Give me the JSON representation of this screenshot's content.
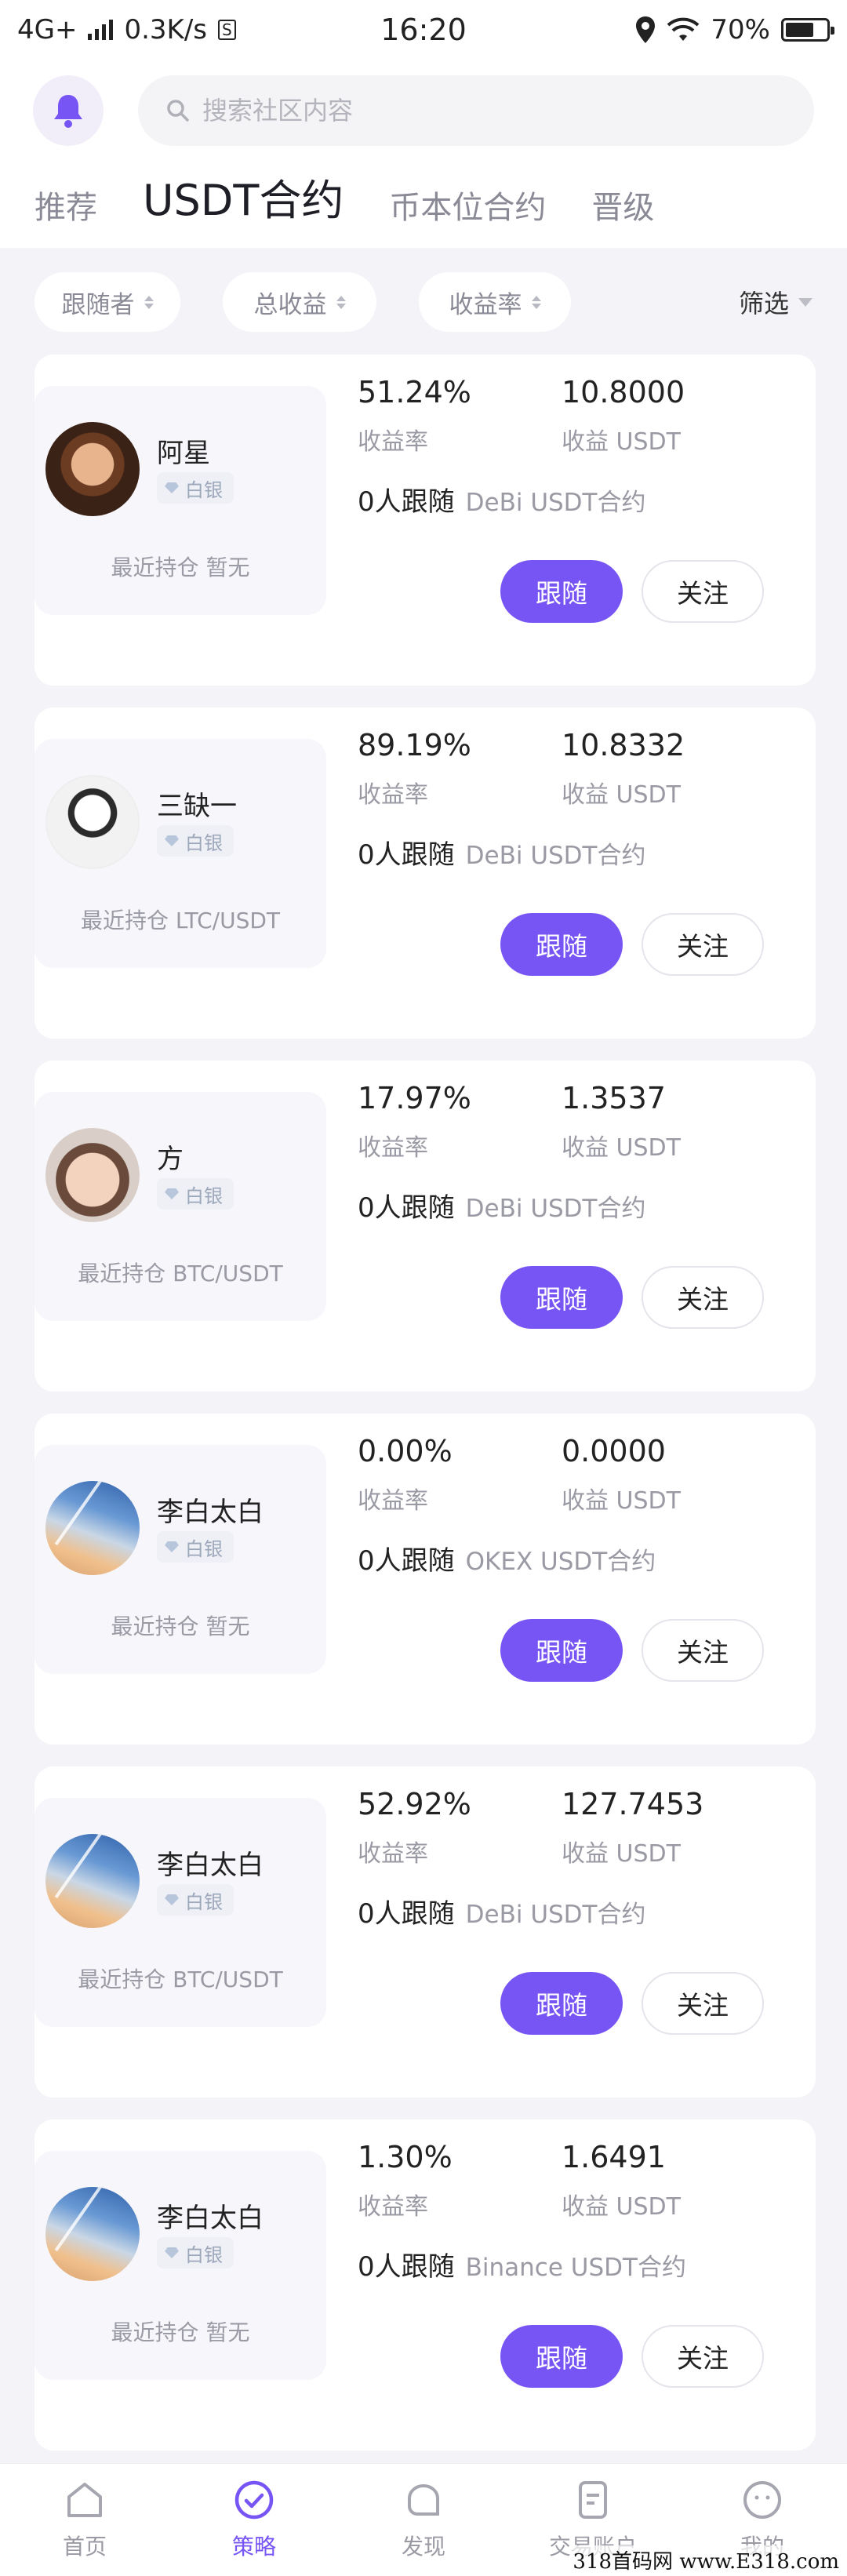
{
  "status_bar": {
    "network": "4G+",
    "speed": "0.3K/s",
    "speed_badge": "S",
    "time": "16:20",
    "battery": "70%",
    "battery_level": 0.7
  },
  "header": {
    "search_placeholder": "搜索社区内容",
    "tabs": [
      {
        "label": "推荐",
        "active": false
      },
      {
        "label": "USDT合约",
        "active": true
      },
      {
        "label": "币本位合约",
        "active": false
      },
      {
        "label": "晋级",
        "active": false
      }
    ]
  },
  "filters": {
    "chips": [
      "跟随者",
      "总收益",
      "收益率"
    ],
    "filter_label": "筛选"
  },
  "labels": {
    "rate": "收益率",
    "profit": "收益 USDT",
    "follow_btn": "跟随",
    "watch_btn": "关注"
  },
  "traders": [
    {
      "name": "阿星",
      "badge": "白银",
      "recent": "最近持仓 暂无",
      "rate": "51.24%",
      "profit": "10.8000",
      "followers": "0人跟随",
      "exchange": "DeBi USDT合约"
    },
    {
      "name": "三缺一",
      "badge": "白银",
      "recent": "最近持仓 LTC/USDT",
      "rate": "89.19%",
      "profit": "10.8332",
      "followers": "0人跟随",
      "exchange": "DeBi USDT合约"
    },
    {
      "name": "方",
      "badge": "白银",
      "recent": "最近持仓 BTC/USDT",
      "rate": "17.97%",
      "profit": "1.3537",
      "followers": "0人跟随",
      "exchange": "DeBi USDT合约"
    },
    {
      "name": "李白太白",
      "badge": "白银",
      "recent": "最近持仓 暂无",
      "rate": "0.00%",
      "profit": "0.0000",
      "followers": "0人跟随",
      "exchange": "OKEX USDT合约"
    },
    {
      "name": "李白太白",
      "badge": "白银",
      "recent": "最近持仓 BTC/USDT",
      "rate": "52.92%",
      "profit": "127.7453",
      "followers": "0人跟随",
      "exchange": "DeBi USDT合约"
    },
    {
      "name": "李白太白",
      "badge": "白银",
      "recent": "最近持仓 暂无",
      "rate": "1.30%",
      "profit": "1.6491",
      "followers": "0人跟随",
      "exchange": "Binance USDT合约"
    }
  ],
  "bottom_nav": [
    {
      "label": "首页",
      "icon": "home-icon",
      "active": false
    },
    {
      "label": "策略",
      "icon": "strategy-check-icon",
      "active": true
    },
    {
      "label": "发现",
      "icon": "discover-chat-icon",
      "active": false
    },
    {
      "label": "交易账户",
      "icon": "account-doc-icon",
      "active": false
    },
    {
      "label": "我的",
      "icon": "profile-face-icon",
      "active": false
    }
  ],
  "watermark": "318首码网  www.E318.com",
  "colors": {
    "accent": "#7755f5",
    "background": "#f4f4f8"
  }
}
